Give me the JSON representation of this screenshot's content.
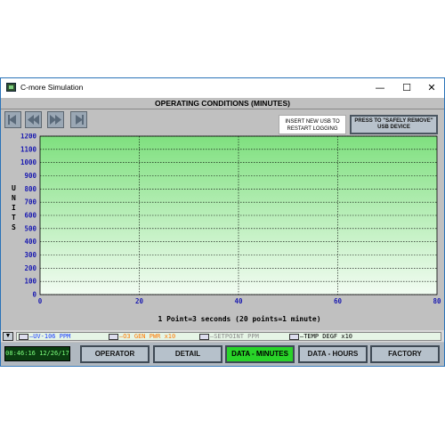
{
  "window": {
    "title": "C-more Simulation",
    "controls": {
      "minimize": "—",
      "maximize": "☐",
      "close": "✕"
    }
  },
  "screen": {
    "title": "OPERATING CONDITIONS (MINUTES)",
    "usb_info": [
      "INSERT NEW USB TO",
      "RESTART LOGGING"
    ],
    "usb_button": [
      "PRESS TO \"SAFELY REMOVE\"",
      "USB DEVICE"
    ],
    "nav_buttons": [
      "left-end-icon",
      "rewind-icon",
      "fast-forward-icon",
      "right-end-icon"
    ]
  },
  "chart_data": {
    "type": "line",
    "ylabel": "UNITS",
    "xlabel": "1 Point=3 seconds (20 points=1 minute)",
    "ylim": [
      0,
      1200
    ],
    "xlim": [
      0,
      80
    ],
    "y_ticks": [
      "0",
      "100",
      "200",
      "300",
      "400",
      "500",
      "600",
      "700",
      "800",
      "900",
      "1000",
      "1100",
      "1200"
    ],
    "x_ticks": [
      "0",
      "20",
      "40",
      "60",
      "80"
    ],
    "grid": true,
    "series": [
      {
        "name": "UV-106 PPM",
        "color": "#1a3cff",
        "values": []
      },
      {
        "name": "O3 GEN PWR x10",
        "color": "#ff7a00",
        "values": []
      },
      {
        "name": "SETPOINT PPM",
        "color": "#8a8a8a",
        "values": []
      },
      {
        "name": "TEMP DEGF x10",
        "color": "#000000",
        "values": []
      }
    ]
  },
  "legend": {
    "arrow": "▼",
    "items": [
      {
        "label": "UV-106 PPM",
        "color": "#1a3cff"
      },
      {
        "label": "O3 GEN PWR x10",
        "color": "#ff7a00"
      },
      {
        "label": "SETPOINT PPM",
        "color": "#8a8a8a"
      },
      {
        "label": "TEMP DEGF x10",
        "color": "#000000"
      }
    ]
  },
  "footer": {
    "clock": "08:46:16 12/26/17",
    "tabs": [
      "OPERATOR",
      "DETAIL",
      "DATA - MINUTES",
      "DATA - HOURS",
      "FACTORY"
    ],
    "active_tab": "DATA - MINUTES",
    "active_color": "#29d329"
  }
}
